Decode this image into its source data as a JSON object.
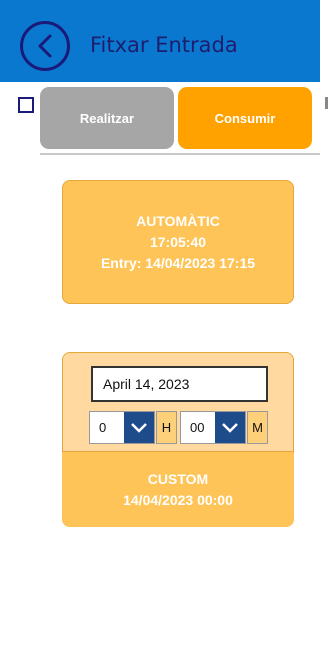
{
  "header": {
    "title": "Fitxar Entrada",
    "back_icon": "chevron-left-icon"
  },
  "actions": {
    "realitzar_label": "Realitzar",
    "consumir_label": "Consumir"
  },
  "automatic": {
    "label": "AUTOMÀTIC",
    "time": "17:05:40",
    "entry": "Entry: 14/04/2023 17:15"
  },
  "custom": {
    "date_value": "April 14, 2023",
    "hour_value": "0",
    "hour_unit": "H",
    "minute_value": "00",
    "minute_unit": "M",
    "label": "CUSTOM",
    "datetime": "14/04/2023 00:00"
  },
  "colors": {
    "header_bg": "#0b78cf",
    "realitzar_bg": "#a6a6a6",
    "consumir_bg": "#ffa200",
    "card_bg": "#ffc457",
    "panel_bg": "#ffd9a0",
    "select_arrow_bg": "#1e4c8a"
  }
}
